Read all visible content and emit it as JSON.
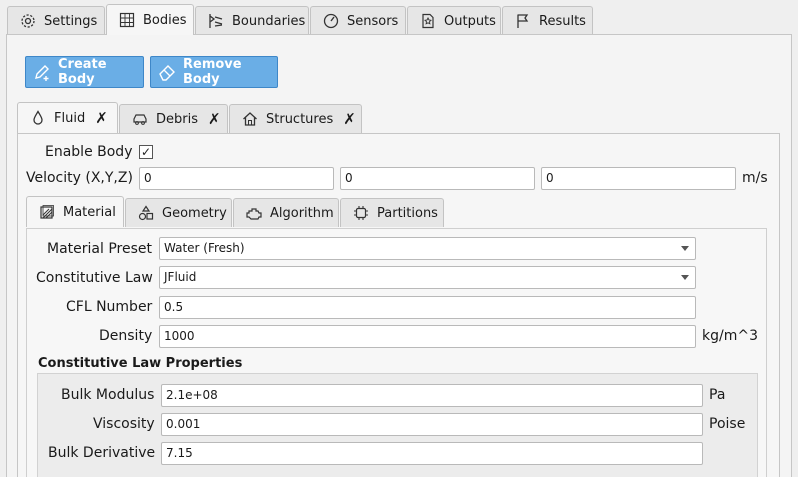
{
  "top_tabs": [
    {
      "label": "Settings",
      "icon": "gear-icon"
    },
    {
      "label": "Bodies",
      "icon": "grid-icon"
    },
    {
      "label": "Boundaries",
      "icon": "boundary-icon"
    },
    {
      "label": "Sensors",
      "icon": "gauge-icon"
    },
    {
      "label": "Outputs",
      "icon": "document-icon"
    },
    {
      "label": "Results",
      "icon": "flag-icon"
    }
  ],
  "active_top_tab": "Bodies",
  "actions": {
    "create_body": "Create Body",
    "remove_body": "Remove Body"
  },
  "body_tabs": [
    {
      "label": "Fluid",
      "icon": "droplet-icon",
      "close": "✗"
    },
    {
      "label": "Debris",
      "icon": "car-icon",
      "close": "✗"
    },
    {
      "label": "Structures",
      "icon": "house-icon",
      "close": "✗"
    }
  ],
  "body": {
    "enable_label": "Enable Body",
    "enabled": "✓",
    "velocity_label": "Velocity (X,Y,Z)",
    "velocity": [
      "0",
      "0",
      "0"
    ],
    "velocity_unit": "m/s"
  },
  "sub_tabs": [
    {
      "label": "Material",
      "icon": "material-icon"
    },
    {
      "label": "Geometry",
      "icon": "shapes-icon"
    },
    {
      "label": "Algorithm",
      "icon": "engine-icon"
    },
    {
      "label": "Partitions",
      "icon": "chip-icon"
    }
  ],
  "material": {
    "preset_label": "Material Preset",
    "preset_value": "Water (Fresh)",
    "law_label": "Constitutive Law",
    "law_value": "JFluid",
    "cfl_label": "CFL Number",
    "cfl_value": "0.5",
    "density_label": "Density",
    "density_value": "1000",
    "density_unit": "kg/m^3"
  },
  "law_props": {
    "title": "Constitutive Law Properties",
    "bulk_label": "Bulk Modulus",
    "bulk_value": "2.1e+08",
    "bulk_unit": "Pa",
    "visc_label": "Viscosity",
    "visc_value": "0.001",
    "visc_unit": "Poise",
    "deriv_label": "Bulk Derivative",
    "deriv_value": "7.15"
  },
  "colors": {
    "accent_button": "#6aaee6",
    "accent_border": "#3e87c8"
  }
}
